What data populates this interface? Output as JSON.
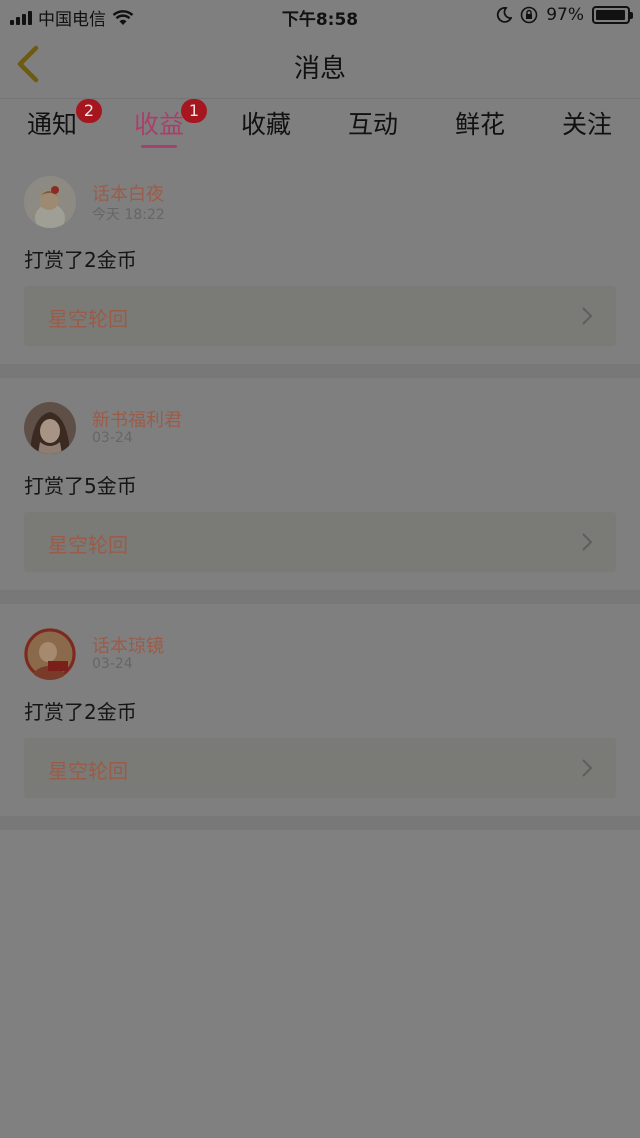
{
  "status_bar": {
    "carrier": "中国电信",
    "time": "下午8:58",
    "battery": "97%",
    "battery_level": 0.97
  },
  "nav": {
    "title": "消息"
  },
  "tabs": [
    {
      "label": "通知",
      "badge": "2"
    },
    {
      "label": "收益",
      "badge": "1",
      "active": true
    },
    {
      "label": "收藏"
    },
    {
      "label": "互动"
    },
    {
      "label": "鲜花"
    },
    {
      "label": "关注"
    }
  ],
  "messages": [
    {
      "user": "话本白夜",
      "time": "今天 18:22",
      "text": "打赏了2金币",
      "book": "星空轮回"
    },
    {
      "user": "新书福利君",
      "time": "03-24",
      "text": "打赏了5金币",
      "book": "星空轮回"
    },
    {
      "user": "话本琼镜",
      "time": "03-24",
      "text": "打赏了2金币",
      "book": "星空轮回"
    }
  ],
  "colors": {
    "accent": "#a8416a",
    "badge": "#a6161f",
    "link_text": "#9a5c49"
  }
}
